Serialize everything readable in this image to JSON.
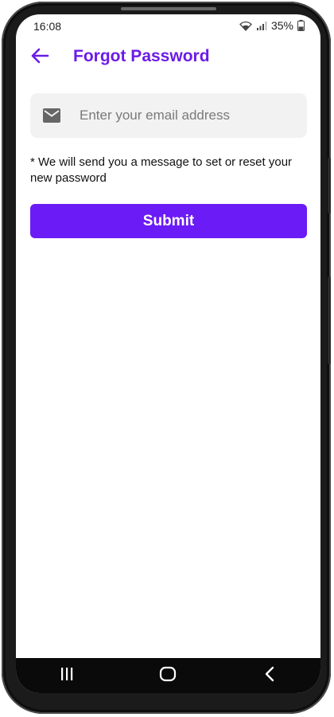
{
  "status_bar": {
    "time": "16:08",
    "battery": "35%",
    "icons": [
      "wifi-icon",
      "signal-icon",
      "battery-icon"
    ]
  },
  "app_bar": {
    "title": "Forgot Password",
    "back_icon": "arrow-left-icon"
  },
  "form": {
    "email_placeholder": "Enter your email address",
    "email_value": "",
    "email_icon": "mail-icon",
    "note": "*  We will send you a message to set or reset your new password",
    "submit_label": "Submit"
  },
  "nav_bar": {
    "icons": [
      "recents-icon",
      "home-icon",
      "back-nav-icon"
    ]
  },
  "colors": {
    "accent": "#6b1bf5",
    "title": "#6b1be8",
    "field_bg": "#f2f2f3"
  }
}
